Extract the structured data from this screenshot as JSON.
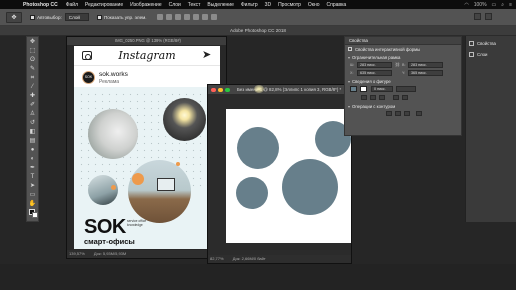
{
  "menubar": {
    "app": "Photoshop CC",
    "items": [
      "Файл",
      "Редактирование",
      "Изображение",
      "Слои",
      "Текст",
      "Выделение",
      "Фильтр",
      "3D",
      "Просмотр",
      "Окно",
      "Справка"
    ],
    "right_text": "100%"
  },
  "options_bar": {
    "tool_icon": "move-icon",
    "autoselect_label": "Автовыбор:",
    "autoselect_value": "Слой",
    "show_controls_label": "Показать упр. элем."
  },
  "app_title": "Adobe Photoshop CC 2018",
  "doc1": {
    "title": "IMG_0250.PNG @ 139% (RGB/8#)",
    "zoom": "139,57%",
    "doc_size": "Док: 5,93M/5,93M",
    "post": {
      "app_title": "Instagram",
      "username": "sok.works",
      "subtitle": "Реклама",
      "avatar_text": "SOK",
      "brand": "SOK",
      "brand_small": "service office knowledge",
      "tagline": "смарт-офисы"
    }
  },
  "doc2": {
    "title": "Без имени-1 @ 82,8% (Эллипс 1 копия 3, RGB/8*) *",
    "zoom": "82,77%",
    "doc_size": "Док: 2,66M/0 байт",
    "circle_color": "#677f8b"
  },
  "properties": {
    "tab": "Свойства",
    "header": "Свойства интерактивной формы",
    "section_bounds": "Ограничительная рамка",
    "w_label": "Ш:",
    "w_value": "283 пикс.",
    "h_label": "В:",
    "h_value": "283 пикс.",
    "x_label": "X:",
    "x_value": "635 пикс.",
    "y_label": "Y:",
    "y_value": "365 пикс.",
    "section_appearance": "Сведения о фигуре",
    "stroke_value": "0 пикс.",
    "section_ops": "Операции с контуром"
  },
  "right_panels": {
    "items": [
      "Свойства",
      "Слои"
    ]
  }
}
